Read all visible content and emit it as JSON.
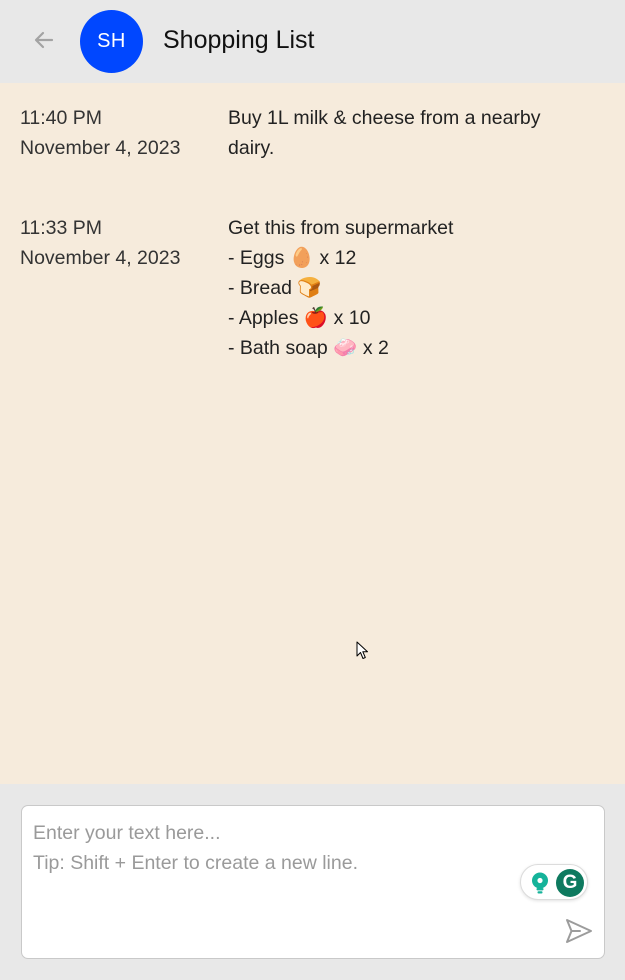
{
  "header": {
    "back_icon": "arrow-left-icon",
    "avatar_initials": "SH",
    "avatar_color": "#0047ff",
    "title": "Shopping List"
  },
  "colors": {
    "header_bg": "#e8e8e8",
    "messages_bg": "#f6ebdc",
    "composer_bg": "#ffffff",
    "grammarly_green": "#0e7a5f"
  },
  "messages": [
    {
      "time": "11:40 PM",
      "date": "November 4, 2023",
      "lines": [
        "Buy 1L milk & cheese from a nearby",
        "dairy."
      ]
    },
    {
      "time": "11:33 PM",
      "date": "November 4, 2023",
      "lines": [
        "Get this from supermarket",
        "- Eggs 🥚 x 12",
        "- Bread 🍞",
        "- Apples 🍎  x 10",
        "- Bath soap 🧼  x 2"
      ]
    }
  ],
  "composer": {
    "placeholder_line1": "Enter your text here...",
    "placeholder_line2": "Tip: Shift + Enter to create a new line.",
    "grammarly_icons": [
      "lightbulb-icon",
      "grammarly-g-icon"
    ],
    "grammarly_letter": "G",
    "send_icon": "send-icon"
  }
}
